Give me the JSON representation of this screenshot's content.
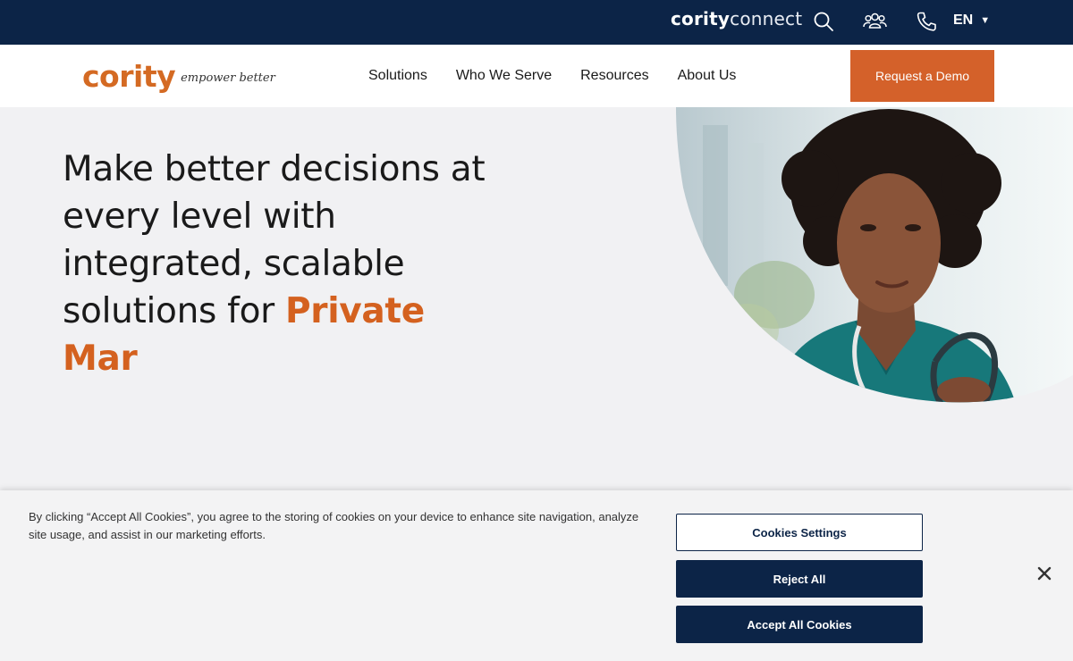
{
  "utility_bar": {
    "connect_brand": "cority",
    "connect_word": "connect",
    "language": "EN",
    "icons": [
      "search-icon",
      "community-icon",
      "phone-icon"
    ]
  },
  "header": {
    "logo_text": "cority",
    "logo_tagline": "empower better",
    "nav": [
      "Solutions",
      "Who We Serve",
      "Resources",
      "About Us"
    ],
    "cta_label": "Request a Demo"
  },
  "hero": {
    "title_plain": "Make better decisions at every level with integrated, scalable solutions for ",
    "title_accent": "Private Mar"
  },
  "cookie_banner": {
    "message": "By clicking “Accept All Cookies”, you agree to the storing of cookies on your device to enhance site navigation, analyze site usage, and assist in our marketing efforts.",
    "settings_label": "Cookies Settings",
    "reject_label": "Reject All",
    "accept_label": "Accept All Cookies"
  },
  "colors": {
    "navy": "#0c2447",
    "orange": "#d4612a",
    "background": "#f1f1f3"
  }
}
